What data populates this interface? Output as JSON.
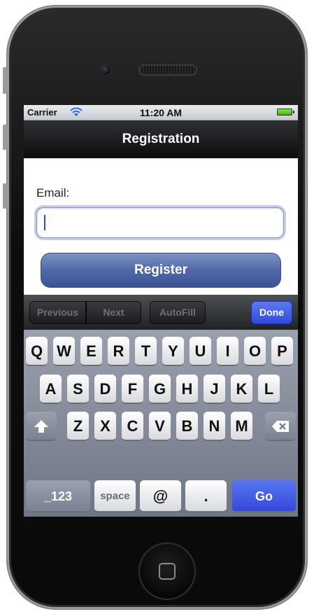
{
  "status_bar": {
    "carrier": "Carrier",
    "time": "11:20 AM"
  },
  "nav": {
    "title": "Registration"
  },
  "form": {
    "email_label": "Email:",
    "email_value": "",
    "register_label": "Register"
  },
  "accessory_bar": {
    "previous": "Previous",
    "next": "Next",
    "autofill": "AutoFill",
    "done": "Done"
  },
  "keyboard": {
    "row1": [
      "Q",
      "W",
      "E",
      "R",
      "T",
      "Y",
      "U",
      "I",
      "O",
      "P"
    ],
    "row2": [
      "A",
      "S",
      "D",
      "F",
      "G",
      "H",
      "J",
      "K",
      "L"
    ],
    "row3": [
      "Z",
      "X",
      "C",
      "V",
      "B",
      "N",
      "M"
    ],
    "numbers_key": "_123",
    "space_key": "space",
    "at_key": "@",
    "dot_key": ".",
    "go_key": "Go",
    "shift_icon": "shift-icon",
    "backspace_icon": "backspace-icon"
  },
  "colors": {
    "accent_blue": "#3448db",
    "nav_bar": "#1a1b1d",
    "register_button": "#5169a8"
  }
}
